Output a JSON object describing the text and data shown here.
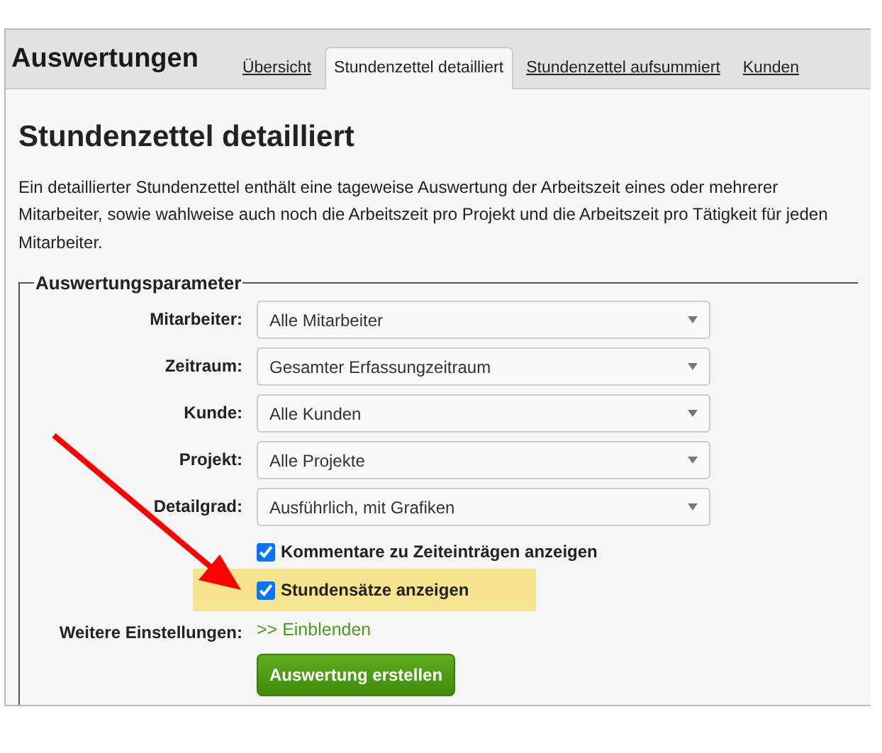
{
  "header": {
    "title": "Auswertungen"
  },
  "tabs": [
    {
      "label": "Übersicht",
      "selected": false
    },
    {
      "label": "Stundenzettel detailliert",
      "selected": true
    },
    {
      "label": "Stundenzettel aufsummiert",
      "selected": false
    },
    {
      "label": "Kunden",
      "selected": false
    }
  ],
  "heading": "Stundenzettel detailliert",
  "description": "Ein detaillierter Stundenzettel enthält eine tageweise Auswertung der Arbeitszeit eines oder mehrerer Mitarbeiter, sowie wahlweise auch noch die Arbeitszeit pro Projekt und die Arbeitszeit pro Tätigkeit für jeden Mitarbeiter.",
  "form": {
    "legend": "Auswertungsparameter",
    "selects": [
      {
        "label": "Mitarbeiter:",
        "value": "Alle Mitarbeiter"
      },
      {
        "label": "Zeitraum:",
        "value": "Gesamter Erfassungzeitraum"
      },
      {
        "label": "Kunde:",
        "value": "Alle Kunden"
      },
      {
        "label": "Projekt:",
        "value": "Alle Projekte"
      },
      {
        "label": "Detailgrad:",
        "value": "Ausführlich, mit Grafiken"
      }
    ],
    "checkboxes": [
      {
        "label": "Kommentare zu Zeiteinträgen anzeigen",
        "checked": true,
        "highlighted": false
      },
      {
        "label": "Stundensätze anzeigen",
        "checked": true,
        "highlighted": true
      }
    ],
    "more": {
      "label": "Weitere Einstellungen:",
      "link": ">> Einblenden"
    },
    "submit": "Auswertung erstellen"
  }
}
